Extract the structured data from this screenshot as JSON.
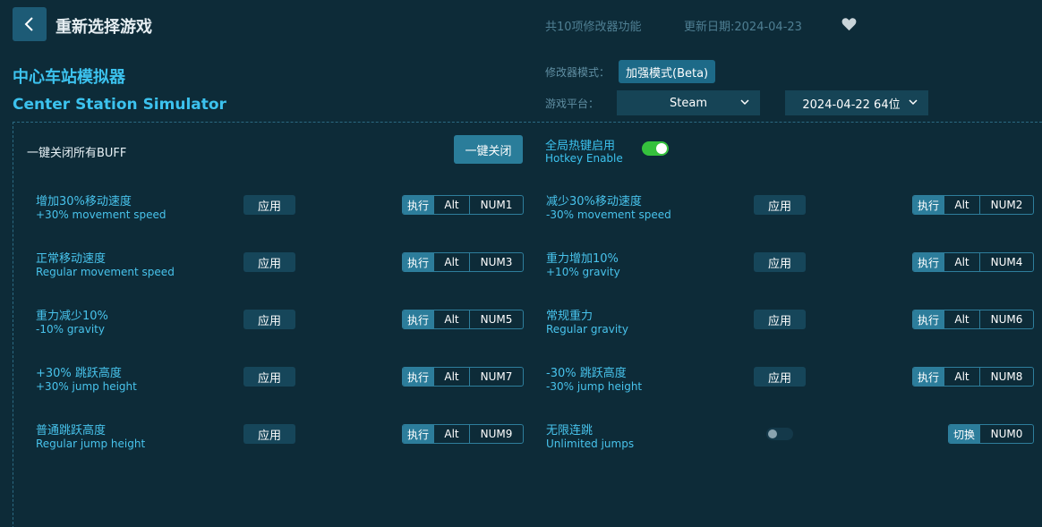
{
  "header": {
    "back_title": "重新选择游戏",
    "feature_count": "共10项修改器功能",
    "update_date": "更新日期:2024-04-23"
  },
  "game": {
    "name_cn": "中心车站模拟器",
    "name_en": "Center Station Simulator"
  },
  "settings": {
    "mode_label": "修改器模式：",
    "mode_value": "加强模式(Beta)",
    "platform_label": "游戏平台：",
    "platform_value": "Steam",
    "version_value": "2024-04-22 64位"
  },
  "global": {
    "close_all_label": "一键关闭所有BUFF",
    "close_all_button": "一键关闭",
    "hotkey_cn": "全局热键启用",
    "hotkey_en": "Hotkey Enable",
    "hotkey_enabled": true
  },
  "labels": {
    "apply": "应用",
    "exec": "执行",
    "alt": "Alt",
    "switch": "切换"
  },
  "cheats": [
    {
      "cn": "增加30%移动速度",
      "en": "+30% movement speed",
      "key": "NUM1"
    },
    {
      "cn": "减少30%移动速度",
      "en": "-30% movement speed",
      "key": "NUM2"
    },
    {
      "cn": "正常移动速度",
      "en": "Regular movement speed",
      "key": "NUM3"
    },
    {
      "cn": "重力增加10%",
      "en": "+10% gravity",
      "key": "NUM4"
    },
    {
      "cn": "重力减少10%",
      "en": "-10% gravity",
      "key": "NUM5"
    },
    {
      "cn": "常规重力",
      "en": "Regular gravity",
      "key": "NUM6"
    },
    {
      "cn": "+30% 跳跃高度",
      "en": "+30% jump height",
      "key": "NUM7"
    },
    {
      "cn": "-30% 跳跃高度",
      "en": "-30% jump height",
      "key": "NUM8"
    },
    {
      "cn": "普通跳跃高度",
      "en": "Regular jump height",
      "key": "NUM9"
    },
    {
      "cn": "无限连跳",
      "en": "Unlimited jumps",
      "key": "NUM0",
      "toggle": true,
      "enabled": false
    }
  ],
  "colors": {
    "background": "#0d2b38",
    "accent": "#3cc2ee",
    "toggle_on": "#35c13d"
  }
}
